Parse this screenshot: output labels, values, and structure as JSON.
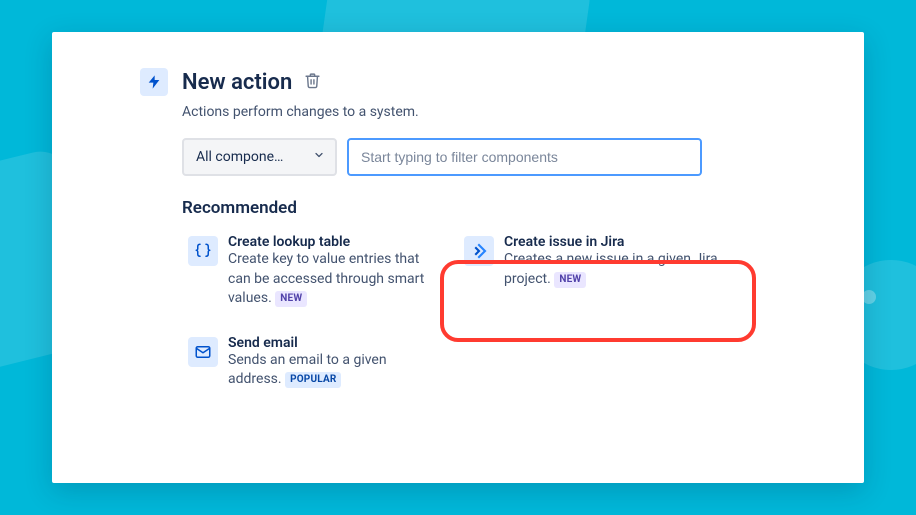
{
  "header": {
    "title": "New action",
    "subtitle": "Actions perform changes to a system."
  },
  "filter": {
    "select_label": "All compone…",
    "placeholder": "Start typing to filter components"
  },
  "section": {
    "recommended": "Recommended"
  },
  "items": {
    "lookup": {
      "title": "Create lookup table",
      "desc": "Create key to value entries that can be accessed through smart values. ",
      "badge": "NEW"
    },
    "jira": {
      "title": "Create issue in Jira",
      "desc": "Creates a new issue in a given Jira project. ",
      "badge": "NEW"
    },
    "email": {
      "title": "Send email",
      "desc": "Sends an email to a given address. ",
      "badge": "POPULAR"
    }
  }
}
